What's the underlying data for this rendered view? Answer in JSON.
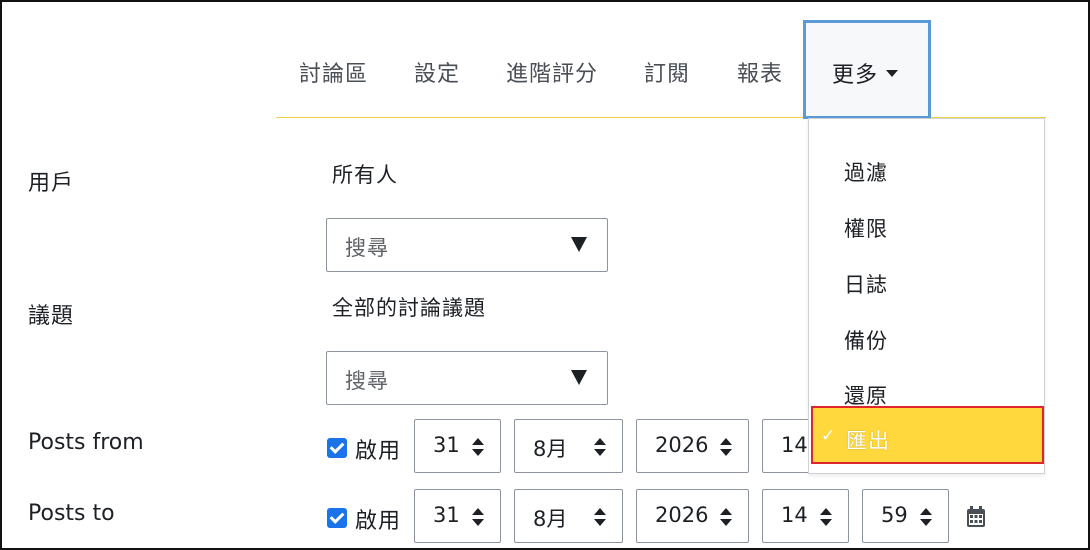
{
  "nav": {
    "tabs": [
      "討論區",
      "設定",
      "進階評分",
      "訂閱",
      "報表"
    ],
    "more_label": "更多"
  },
  "dropdown": {
    "items": [
      "過濾",
      "權限",
      "日誌",
      "備份",
      "還原",
      "匯出"
    ],
    "active_item": "匯出"
  },
  "form": {
    "user_label": "用戶",
    "user_value": "所有人",
    "user_search_placeholder": "搜尋",
    "topic_label": "議題",
    "topic_value": "全部的討論議題",
    "topic_search_placeholder": "搜尋",
    "posts_from": {
      "label": "Posts from",
      "enable_label": "啟用",
      "enabled": true,
      "day": "31",
      "month": "8月",
      "year": "2026",
      "hour": "14"
    },
    "posts_to": {
      "label": "Posts to",
      "enable_label": "啟用",
      "enabled": true,
      "day": "31",
      "month": "8月",
      "year": "2026",
      "hour": "14",
      "minute": "59"
    }
  },
  "icons": {
    "calendar": "calendar-icon",
    "check": "check-icon"
  },
  "colors": {
    "active_bg": "#ffd83d",
    "active_border": "#e0262a",
    "focus_border": "#5b9bd5",
    "checkbox": "#1a73e8"
  }
}
